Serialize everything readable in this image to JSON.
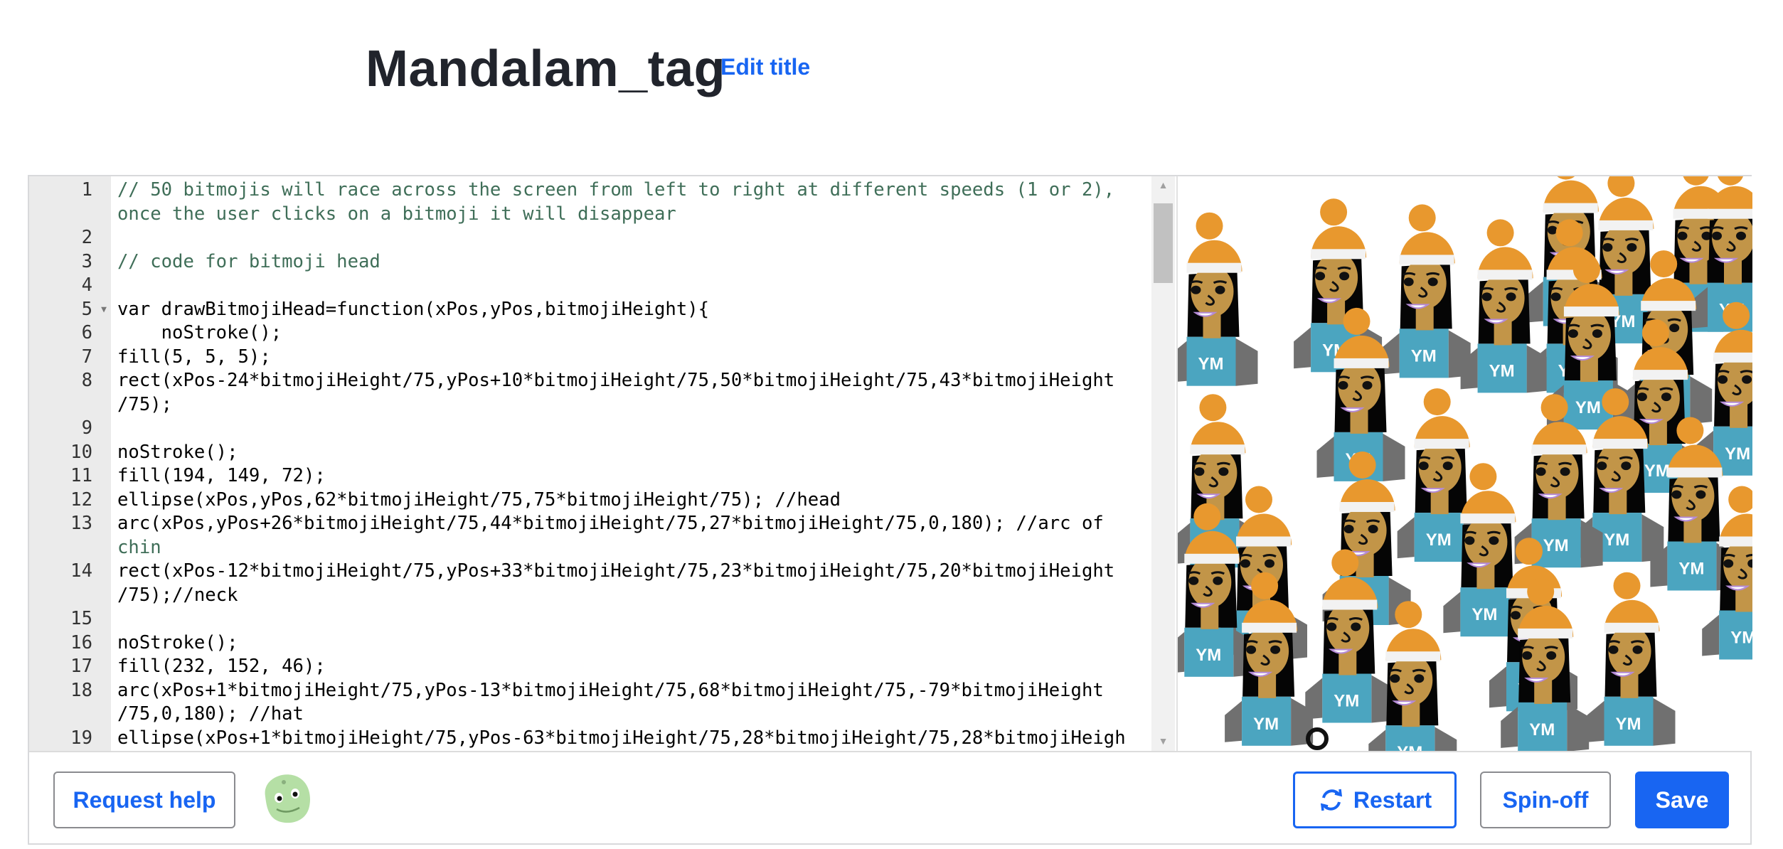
{
  "header": {
    "title": "Mandalam_tag",
    "edit_title_label": "Edit title"
  },
  "editor": {
    "lines": [
      {
        "n": "1",
        "rows": [
          "// 50 bitmojis will race across the screen from left to right at different speeds (1 or 2),",
          "once the user clicks on a bitmoji it will disappear"
        ]
      },
      {
        "n": "2",
        "rows": [
          ""
        ]
      },
      {
        "n": "3",
        "rows": [
          "// code for bitmoji head"
        ]
      },
      {
        "n": "4",
        "rows": [
          ""
        ]
      },
      {
        "n": "5",
        "fold": true,
        "rows": [
          "var drawBitmojiHead=function(xPos,yPos,bitmojiHeight){"
        ]
      },
      {
        "n": "6",
        "rows": [
          "    noStroke();"
        ]
      },
      {
        "n": "7",
        "rows": [
          "fill(5, 5, 5);"
        ]
      },
      {
        "n": "8",
        "rows": [
          "rect(xPos-24*bitmojiHeight/75,yPos+10*bitmojiHeight/75,50*bitmojiHeight/75,43*bitmojiHeight",
          "/75);"
        ]
      },
      {
        "n": "9",
        "rows": [
          ""
        ]
      },
      {
        "n": "10",
        "rows": [
          "noStroke();"
        ]
      },
      {
        "n": "11",
        "rows": [
          "fill(194, 149, 72);"
        ]
      },
      {
        "n": "12",
        "rows": [
          "ellipse(xPos,yPos,62*bitmojiHeight/75,75*bitmojiHeight/75); //head"
        ]
      },
      {
        "n": "13",
        "rows": [
          "arc(xPos,yPos+26*bitmojiHeight/75,44*bitmojiHeight/75,27*bitmojiHeight/75,0,180); //arc of",
          "chin"
        ]
      },
      {
        "n": "14",
        "rows": [
          "rect(xPos-12*bitmojiHeight/75,yPos+33*bitmojiHeight/75,23*bitmojiHeight/75,20*bitmojiHeight",
          "/75);//neck"
        ]
      },
      {
        "n": "15",
        "rows": [
          ""
        ]
      },
      {
        "n": "16",
        "rows": [
          "noStroke();"
        ]
      },
      {
        "n": "17",
        "rows": [
          "fill(232, 152, 46);"
        ]
      },
      {
        "n": "18",
        "rows": [
          "arc(xPos+1*bitmojiHeight/75,yPos-13*bitmojiHeight/75,68*bitmojiHeight/75,-79*bitmojiHeight",
          "/75,0,180); //hat"
        ]
      },
      {
        "n": "19",
        "rows": [
          "ellipse(xPos+1*bitmojiHeight/75,yPos-63*bitmojiHeight/75,28*bitmojiHeight/75,28*bitmojiHeigh"
        ]
      }
    ],
    "syntax_colors": {
      "comment": "#4d7f69",
      "number": "#1a1aa6",
      "operator": "#6c7a89",
      "keyword": "#1a3bd6",
      "param": "#2e7d9a",
      "text": "#000000"
    }
  },
  "canvas": {
    "shirt_label": "YM",
    "colors": {
      "skin": "#c29548",
      "hair": "#050505",
      "hat": "#e8982e",
      "hat_band": "#f2f2f2",
      "shirt": "#4ba5c0",
      "jacket": "#707070",
      "smile_outline": "#b48ad6"
    }
  },
  "toolbar": {
    "request_help_label": "Request help",
    "restart_label": "Restart",
    "spinoff_label": "Spin-off",
    "save_label": "Save",
    "accent_color": "#1865f2"
  }
}
